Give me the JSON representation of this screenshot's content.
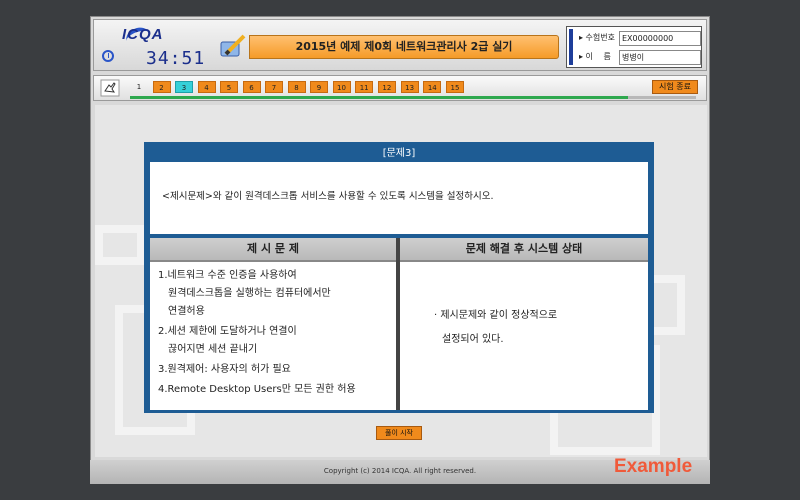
{
  "header": {
    "logo": "ICQA",
    "timer": "34:51",
    "exam_title": "2015년 예제 제0회 네트워크관리사 2급 실기",
    "exam_number_label": "▸ 수험번호",
    "exam_number_value": "EX00000000",
    "name_label": "▸ 이 　름",
    "name_value": "병병이"
  },
  "nav": {
    "questions": [
      "1",
      "2",
      "3",
      "4",
      "5",
      "6",
      "7",
      "8",
      "9",
      "10",
      "11",
      "12",
      "13",
      "14",
      "15"
    ],
    "current": "3",
    "end_button": "시험 종료",
    "progress": 0.88
  },
  "question": {
    "title": "[문제3]",
    "prompt": "<제시문제>와 같이 원격데스크톱 서비스를 사용할 수 있도록 시스템을 설정하시오.",
    "left_header": "제 시 문 제",
    "right_header": "문제 해결 후 시스템 상태",
    "requirements": [
      "1.네트워크 수준 인증을 사용하여",
      "  원격데스크톱을 실행하는 컴퓨터에서만",
      "  연결허용",
      "2.세션 제한에 도달하거나 연결이",
      "  끊어지면 세션 끝내기",
      "3.원격제어: 사용자의 허가 필요",
      "4.Remote Desktop Users만 모든 권한 허용"
    ],
    "state_lines": [
      "· 제시문제와 같이 정상적으로",
      "설정되어 있다."
    ]
  },
  "start_button": "풀이 시작",
  "copyright": "Copyright (c) 2014 ICQA. All right reserved.",
  "watermark": "Example",
  "colors": {
    "accent_orange": "#f08a1c",
    "current_cyan": "#35d0d8",
    "panel_blue": "#1e5c94",
    "watermark_red": "#f05a3a"
  }
}
